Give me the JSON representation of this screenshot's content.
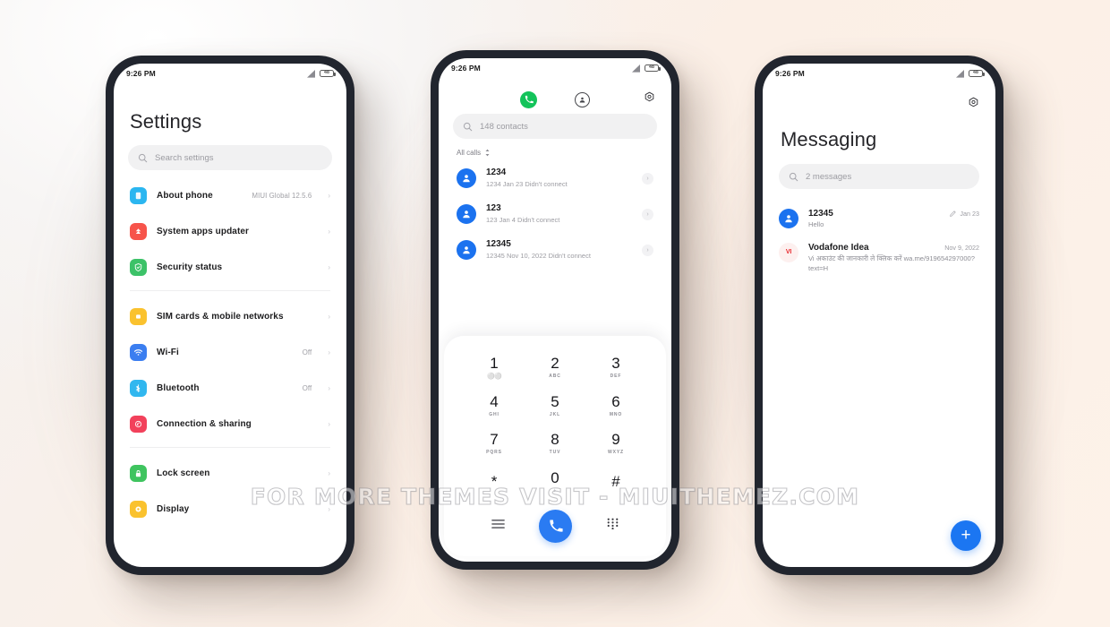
{
  "watermark": "FOR MORE THEMES VISIT - MIUITHEMEZ.COM",
  "status_bar": {
    "time": "9:26 PM",
    "battery_level": "48"
  },
  "settings_phone": {
    "title": "Settings",
    "search_placeholder": "Search settings",
    "groups": [
      {
        "items": [
          {
            "label": "About phone",
            "value": "MIUI Global 12.5.6",
            "icon": "about-phone-icon",
            "color": "#2bb6f0"
          },
          {
            "label": "System apps updater",
            "value": "",
            "icon": "system-apps-updater-icon",
            "color": "#f7544b"
          },
          {
            "label": "Security status",
            "value": "",
            "icon": "security-status-icon",
            "color": "#3cc268"
          }
        ]
      },
      {
        "items": [
          {
            "label": "SIM cards & mobile networks",
            "value": "",
            "icon": "sim-card-icon",
            "color": "#fac22e"
          },
          {
            "label": "Wi-Fi",
            "value": "Off",
            "icon": "wifi-icon",
            "color": "#3b7ef0"
          },
          {
            "label": "Bluetooth",
            "value": "Off",
            "icon": "bluetooth-icon",
            "color": "#31b7ef"
          },
          {
            "label": "Connection & sharing",
            "value": "",
            "icon": "connection-sharing-icon",
            "color": "#f2415b"
          }
        ]
      },
      {
        "items": [
          {
            "label": "Lock screen",
            "value": "",
            "icon": "lock-icon",
            "color": "#3fc45f"
          },
          {
            "label": "Display",
            "value": "",
            "icon": "display-icon",
            "color": "#fac22e"
          }
        ]
      }
    ]
  },
  "dialer_phone": {
    "tabs": [
      {
        "name": "keypad-tab",
        "icon": "phone-icon",
        "active": true
      },
      {
        "name": "contacts-tab",
        "icon": "person-circle-icon",
        "active": false
      }
    ],
    "settings_icon": "gear-icon",
    "search_placeholder": "148 contacts",
    "filter_label": "All calls",
    "calls": [
      {
        "name": "1234",
        "detail": "1234  Jan 23 Didn't connect"
      },
      {
        "name": "123",
        "detail": "123  Jan 4 Didn't connect"
      },
      {
        "name": "12345",
        "detail": "12345  Nov 10, 2022 Didn't connect"
      }
    ],
    "keypad": [
      {
        "num": "1",
        "sub": "",
        "voicemail": true
      },
      {
        "num": "2",
        "sub": "ABC"
      },
      {
        "num": "3",
        "sub": "DEF"
      },
      {
        "num": "4",
        "sub": "GHI"
      },
      {
        "num": "5",
        "sub": "JKL"
      },
      {
        "num": "6",
        "sub": "MNO"
      },
      {
        "num": "7",
        "sub": "PQRS"
      },
      {
        "num": "8",
        "sub": "TUV"
      },
      {
        "num": "9",
        "sub": "WXYZ"
      },
      {
        "num": "*",
        "sub": ""
      },
      {
        "num": "0",
        "sub": "+"
      },
      {
        "num": "#",
        "sub": ""
      }
    ],
    "bottom_bar": [
      {
        "name": "menu-icon"
      },
      {
        "name": "call-button"
      },
      {
        "name": "dialpad-icon"
      }
    ]
  },
  "messaging_phone": {
    "title": "Messaging",
    "settings_icon": "gear-icon",
    "search_placeholder": "2 messages",
    "threads": [
      {
        "name": "12345",
        "preview": "Hello",
        "date": "Jan 23",
        "has_draft_icon": true,
        "avatar_type": "person",
        "avatar_text": ""
      },
      {
        "name": "Vodafone Idea",
        "preview": "Vi अकाउंट की जानकारी ले क्लिक करें wa.me/919654297000?text=H",
        "date": "Nov 9, 2022",
        "has_draft_icon": false,
        "avatar_type": "initials",
        "avatar_text": "VI"
      }
    ],
    "compose_fab": "+"
  }
}
